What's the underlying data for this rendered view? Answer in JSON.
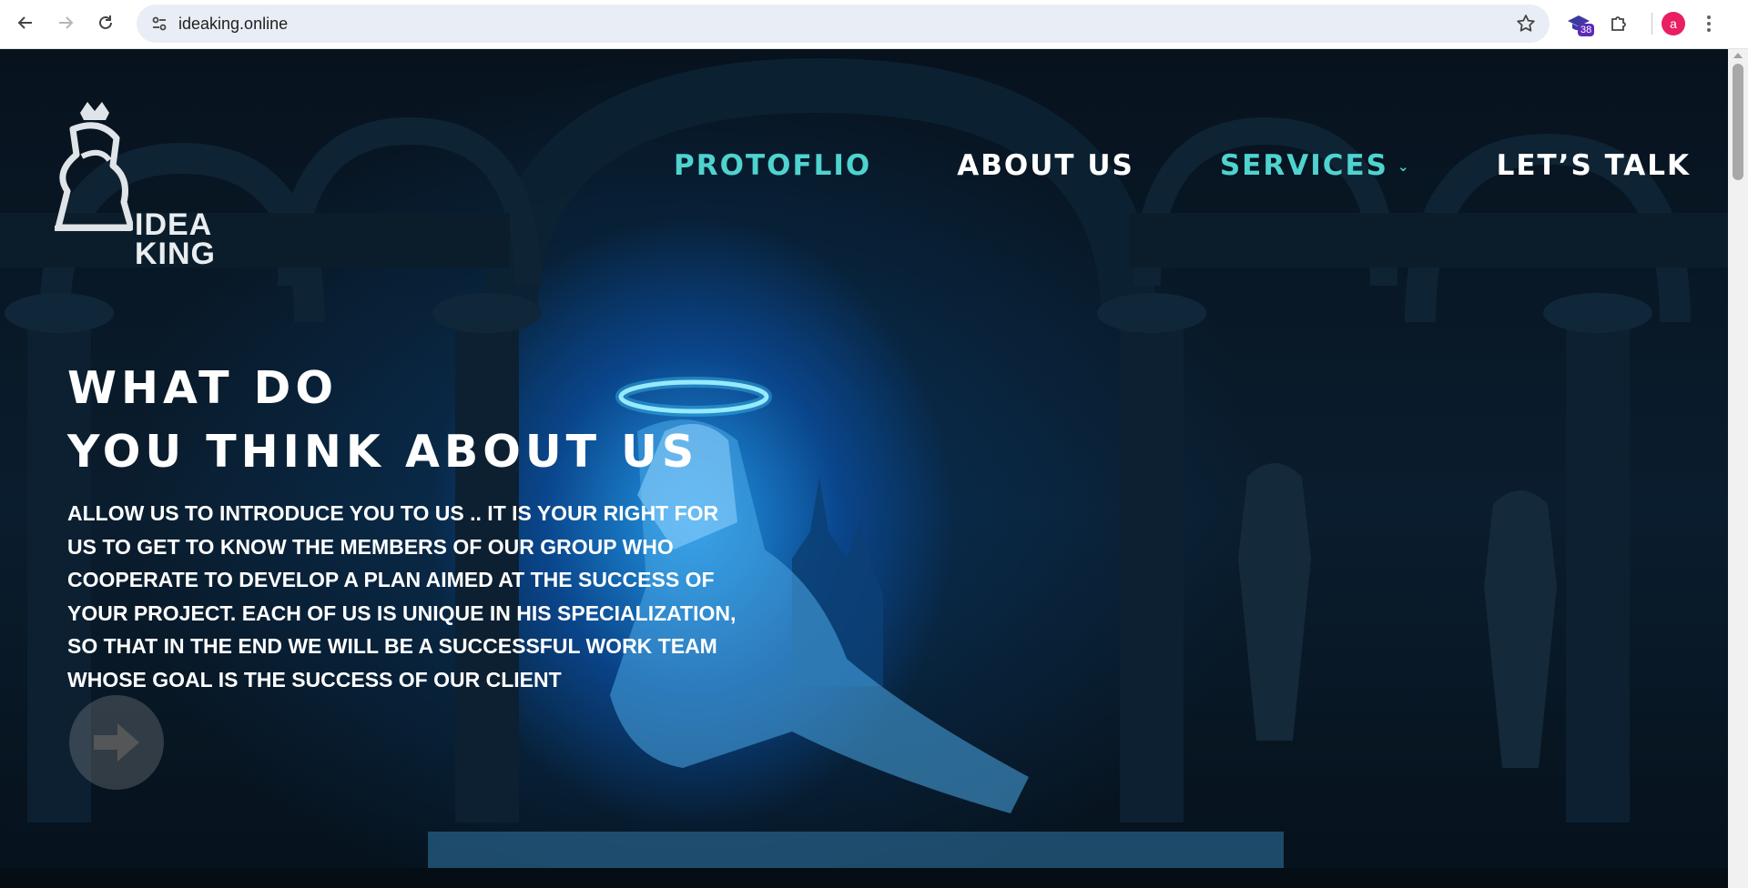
{
  "browser": {
    "url": "ideaking.online",
    "extension_badge": "38",
    "profile_initial": "a"
  },
  "site": {
    "logo_line1": "IDEA",
    "logo_line2": "KING",
    "nav": [
      {
        "label": "PROTOFLIO",
        "accent": true
      },
      {
        "label": "ABOUT US",
        "accent": false
      },
      {
        "label": "SERVICES",
        "accent": true,
        "dropdown": true
      },
      {
        "label": "LET’S TALK",
        "accent": false
      }
    ]
  },
  "hero": {
    "title_line1": "WHAT DO",
    "title_line2": "YOU THINK ABOUT US",
    "body": "ALLOW US TO INTRODUCE YOU TO US .. IT IS YOUR RIGHT FOR US TO GET TO KNOW THE MEMBERS OF OUR GROUP WHO COOPERATE TO DEVELOP A PLAN AIMED AT THE SUCCESS OF YOUR PROJECT. EACH OF US IS UNIQUE IN HIS SPECIALIZATION, SO THAT IN THE END WE WILL BE A SUCCESSFUL WORK TEAM WHOSE GOAL IS THE SUCCESS OF OUR CLIENT"
  },
  "icons": {
    "back": "arrow-left-icon",
    "forward": "arrow-right-icon",
    "reload": "reload-icon",
    "site_info": "tune-icon",
    "bookmark": "star-icon",
    "extension": "graduation-cap-icon",
    "extensions_menu": "puzzle-icon",
    "menu": "kebab-icon",
    "next": "arrow-right-icon"
  },
  "colors": {
    "accent": "#4ed3cf",
    "nav_white": "#ffffff",
    "glow": "#28aaff"
  }
}
